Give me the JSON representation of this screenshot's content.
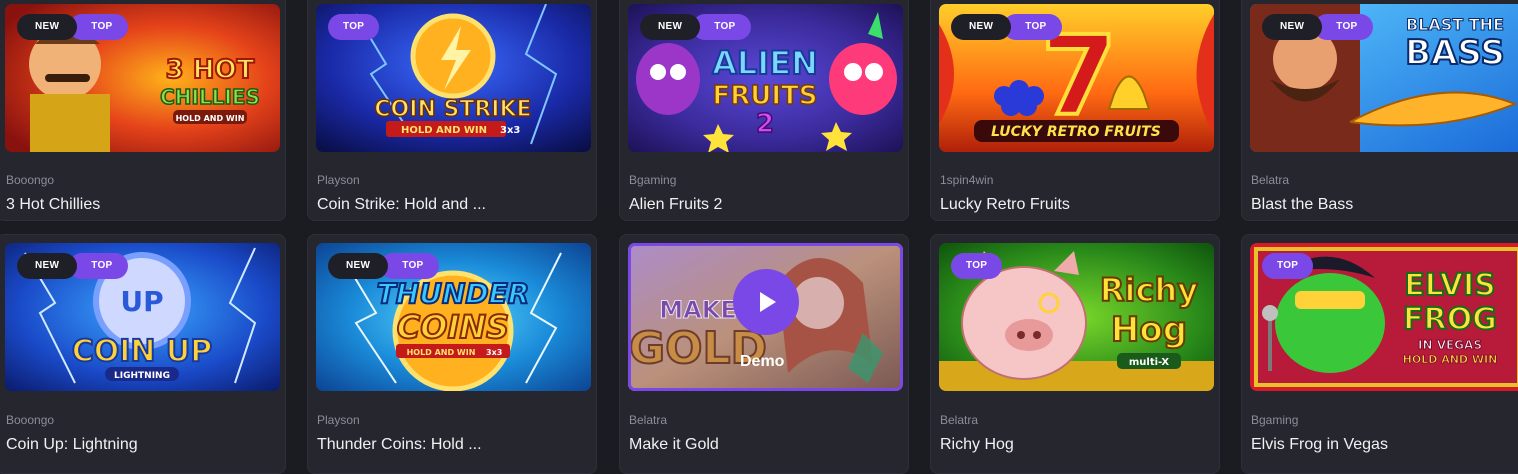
{
  "badges": {
    "new": "NEW",
    "top": "TOP"
  },
  "play_overlay": {
    "label": "Demo"
  },
  "row1": [
    {
      "provider": "Booongo",
      "title": "3 Hot Chillies",
      "art": [
        "3 HOT",
        "CHILLIES",
        "HOLD AND WIN"
      ],
      "new": true,
      "top": true
    },
    {
      "provider": "Playson",
      "title": "Coin Strike: Hold and ...",
      "art": [
        "COIN STRIKE",
        "HOLD AND WIN",
        "3x3"
      ],
      "new": false,
      "top": true
    },
    {
      "provider": "Bgaming",
      "title": "Alien Fruits 2",
      "art": [
        "ALIEN",
        "FRUITS",
        "2"
      ],
      "new": true,
      "top": true
    },
    {
      "provider": "1spin4win",
      "title": "Lucky Retro Fruits",
      "art": [
        "7",
        "LUCKY RETRO FRUITS"
      ],
      "new": true,
      "top": true
    },
    {
      "provider": "Belatra",
      "title": "Blast the Bass",
      "art": [
        "BLAST THE",
        "BASS"
      ],
      "new": true,
      "top": true
    }
  ],
  "row2": [
    {
      "provider": "Booongo",
      "title": "Coin Up: Lightning",
      "art": [
        "UP",
        "COIN UP",
        "LIGHTNING"
      ],
      "new": true,
      "top": true
    },
    {
      "provider": "Playson",
      "title": "Thunder Coins: Hold ...",
      "art": [
        "THUNDER",
        "COINS",
        "HOLD AND WIN",
        "3x3"
      ],
      "new": true,
      "top": true
    },
    {
      "provider": "Belatra",
      "title": "Make it Gold",
      "art": [
        "MAKE",
        "GOLD"
      ],
      "new": false,
      "top": false
    },
    {
      "provider": "Belatra",
      "title": "Richy Hog",
      "art": [
        "Richy",
        "Hog",
        "multi-X"
      ],
      "new": false,
      "top": true
    },
    {
      "provider": "Bgaming",
      "title": "Elvis Frog in Vegas",
      "art": [
        "ELVIS",
        "FROG",
        "IN VEGAS",
        "HOLD AND WIN"
      ],
      "new": false,
      "top": true
    }
  ]
}
